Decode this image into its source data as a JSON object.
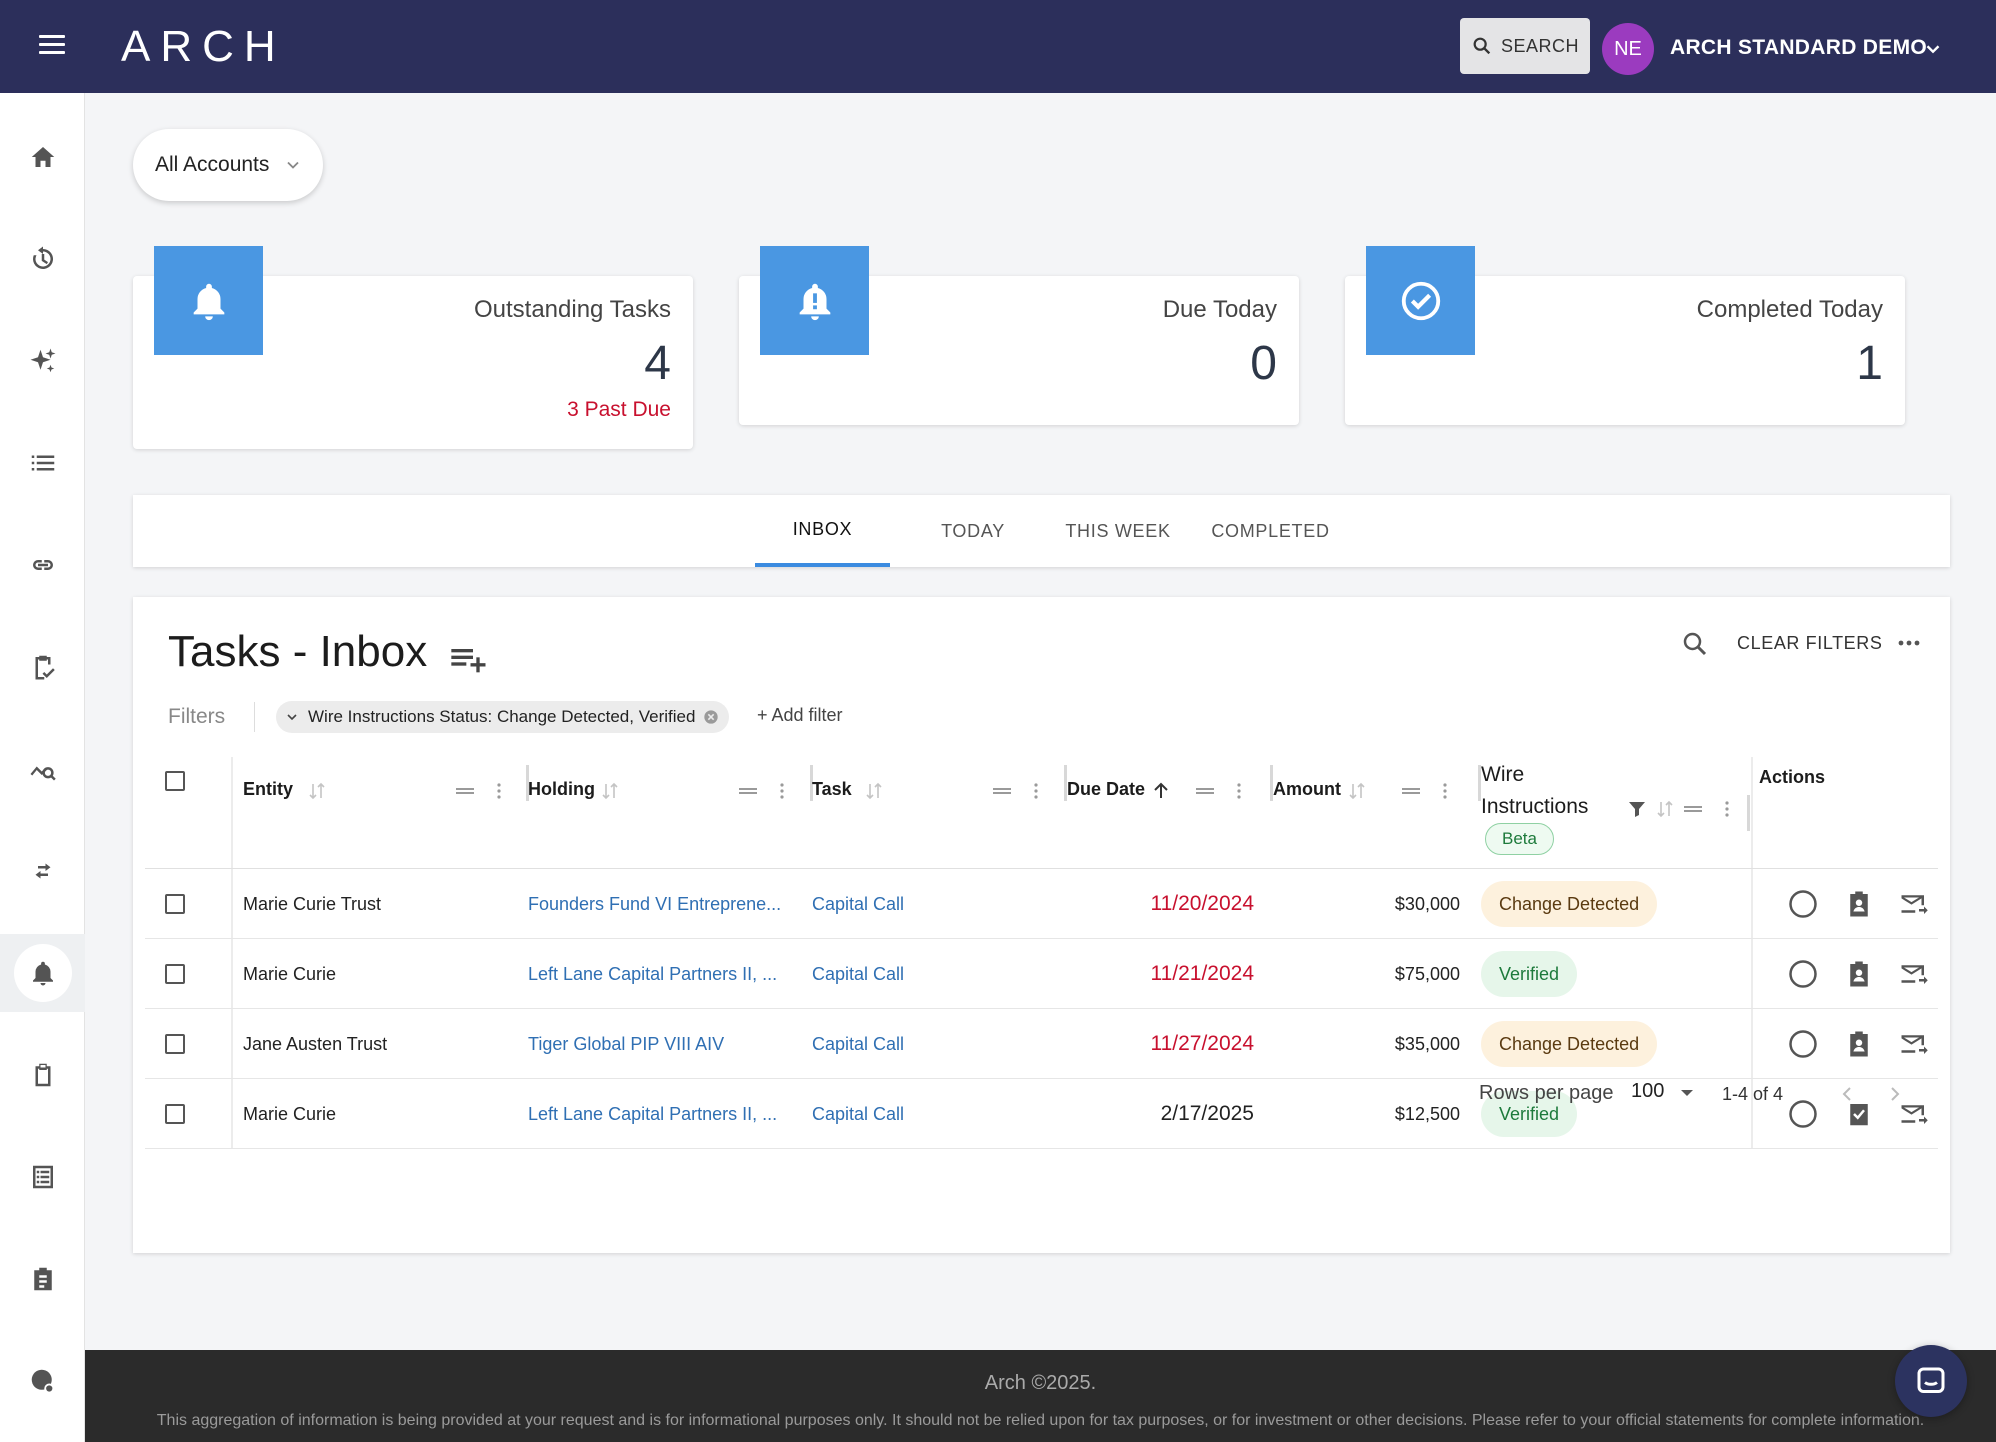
{
  "header": {
    "logo": "ARCH",
    "search_label": "SEARCH",
    "avatar_initials": "NE",
    "account_name": "ARCH STANDARD DEMO"
  },
  "sidebar": {
    "items": [
      "home",
      "history",
      "insights",
      "list",
      "link",
      "task-check",
      "analytics",
      "transfer",
      "notifications",
      "clipboard",
      "document-list",
      "assignment",
      "globe-settings"
    ],
    "active": "notifications"
  },
  "account_filter": {
    "value": "All Accounts"
  },
  "cards": [
    {
      "label": "Outstanding Tasks",
      "value": "4",
      "sub": "3 Past Due",
      "icon": "bell-icon"
    },
    {
      "label": "Due Today",
      "value": "0",
      "icon": "bell-alert-icon"
    },
    {
      "label": "Completed Today",
      "value": "1",
      "icon": "check-circle-icon"
    }
  ],
  "tabs": [
    {
      "label": "INBOX",
      "active": true
    },
    {
      "label": "TODAY",
      "active": false
    },
    {
      "label": "THIS WEEK",
      "active": false
    },
    {
      "label": "COMPLETED",
      "active": false
    }
  ],
  "panel": {
    "title": "Tasks - Inbox",
    "clear_filters": "CLEAR FILTERS",
    "filters_label": "Filters",
    "filter_chip": "Wire Instructions Status: Change Detected, Verified",
    "add_filter": "+ Add filter"
  },
  "table": {
    "columns": {
      "entity": "Entity",
      "holding": "Holding",
      "task": "Task",
      "due_date": "Due Date",
      "amount": "Amount",
      "wire_line1": "Wire",
      "wire_line2": "Instructions",
      "wire_badge": "Beta",
      "actions": "Actions"
    },
    "rows": [
      {
        "entity": "Marie Curie Trust",
        "holding": "Founders Fund VI Entreprene...",
        "task": "Capital Call",
        "due_date": "11/20/2024",
        "past_due": true,
        "amount": "$30,000",
        "wire": "Change Detected"
      },
      {
        "entity": "Marie Curie",
        "holding": "Left Lane Capital Partners II, ...",
        "task": "Capital Call",
        "due_date": "11/21/2024",
        "past_due": true,
        "amount": "$75,000",
        "wire": "Verified"
      },
      {
        "entity": "Jane Austen Trust",
        "holding": "Tiger Global PIP VIII AIV",
        "task": "Capital Call",
        "due_date": "11/27/2024",
        "past_due": true,
        "amount": "$35,000",
        "wire": "Change Detected"
      },
      {
        "entity": "Marie Curie",
        "holding": "Left Lane Capital Partners II, ...",
        "task": "Capital Call",
        "due_date": "2/17/2025",
        "past_due": false,
        "amount": "$12,500",
        "wire": "Verified"
      }
    ]
  },
  "pagination": {
    "rows_per_page_label": "Rows per page",
    "rows_per_page": "100",
    "range": "1-4 of 4"
  },
  "footer": {
    "copyright": "Arch ©2025.",
    "disclaimer": "This aggregation of information is being provided at your request and is for informational purposes only. It should not be relied upon for tax purposes, or for investment or other decisions. Please refer to your official statements for complete information."
  },
  "colors": {
    "topbar": "#2c2f5b",
    "accent": "#4a97e2",
    "past_due": "#c8102e",
    "link": "#2f6fb3"
  }
}
